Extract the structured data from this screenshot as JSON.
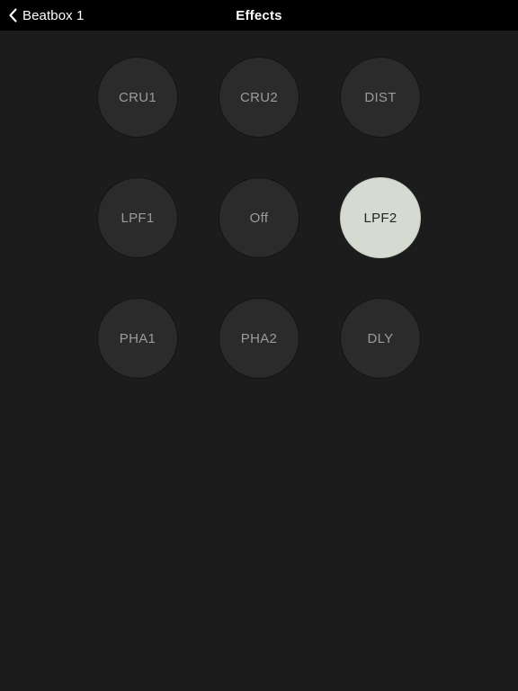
{
  "navbar": {
    "back_label": "Beatbox 1",
    "back_icon": "chevron-left-icon",
    "title": "Effects",
    "background_color": "#000000",
    "text_color": "#ffffff"
  },
  "theme": {
    "page_background": "#1c1c1c",
    "pad_background": "#2b2b2b",
    "pad_border": "#141414",
    "pad_label_color": "#9b9b9b",
    "selected_pad_background": "#d6dbd2",
    "selected_pad_label_color": "#24251f"
  },
  "effects_grid": {
    "columns": 3,
    "rows": 3,
    "selected": "LPF2",
    "pads": [
      [
        {
          "label": "CRU1",
          "selected": false
        },
        {
          "label": "CRU2",
          "selected": false
        },
        {
          "label": "DIST",
          "selected": false
        }
      ],
      [
        {
          "label": "LPF1",
          "selected": false
        },
        {
          "label": "Off",
          "selected": false
        },
        {
          "label": "LPF2",
          "selected": true
        }
      ],
      [
        {
          "label": "PHA1",
          "selected": false
        },
        {
          "label": "PHA2",
          "selected": false
        },
        {
          "label": "DLY",
          "selected": false
        }
      ]
    ]
  }
}
